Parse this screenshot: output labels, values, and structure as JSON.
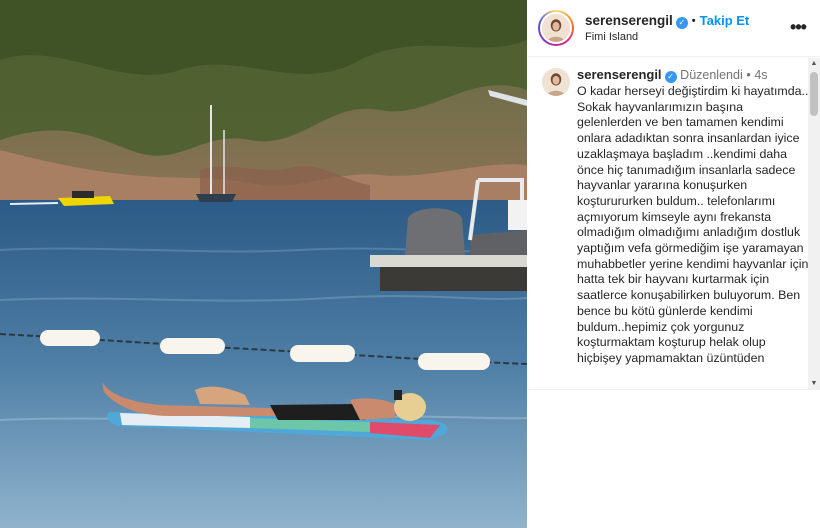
{
  "photo": {
    "alt_name": "beach-photo"
  },
  "header": {
    "username": "serenserengil",
    "verified_icon": "verified-icon",
    "separator": "•",
    "follow_label": "Takip Et",
    "location": "Fimi Island",
    "more_icon": "more-options-icon"
  },
  "caption": {
    "username": "serenserengil",
    "edited_label": "Düzenlendi",
    "separator": "•",
    "time_ago": "4s",
    "text": "O kadar herseyi değiştirdim ki hayatımda..\nSokak hayvanlarımızın başına gelenlerden ve ben tamamen kendimi onlara adadıktan sonra insanlardan iyice uzaklaşmaya başladım ..kendimi daha önce hiç tanımadığım insanlarla sadece hayvanlar yararına konuşurken koşturururken buldum.. telefonlarımı açmıyorum  kimseyle aynı frekansta olmadığım olmadığımı anladığım dostluk yaptığım vefa görmediğim işe yaramayan muhabbetler yerine kendimi hayvanlar için hatta tek bir hayvanı kurtarmak için saatlerce konuşabilirken buluyorum. Ben bence bu kötü günlerde kendimi buldum..hepimiz çok yorgunuz koşturmaktam koşturup helak olup hiçbişey yapmamaktan üzüntüden"
  },
  "colors": {
    "accent": "#0095f6",
    "verified": "#3897f0",
    "muted": "#737373"
  }
}
